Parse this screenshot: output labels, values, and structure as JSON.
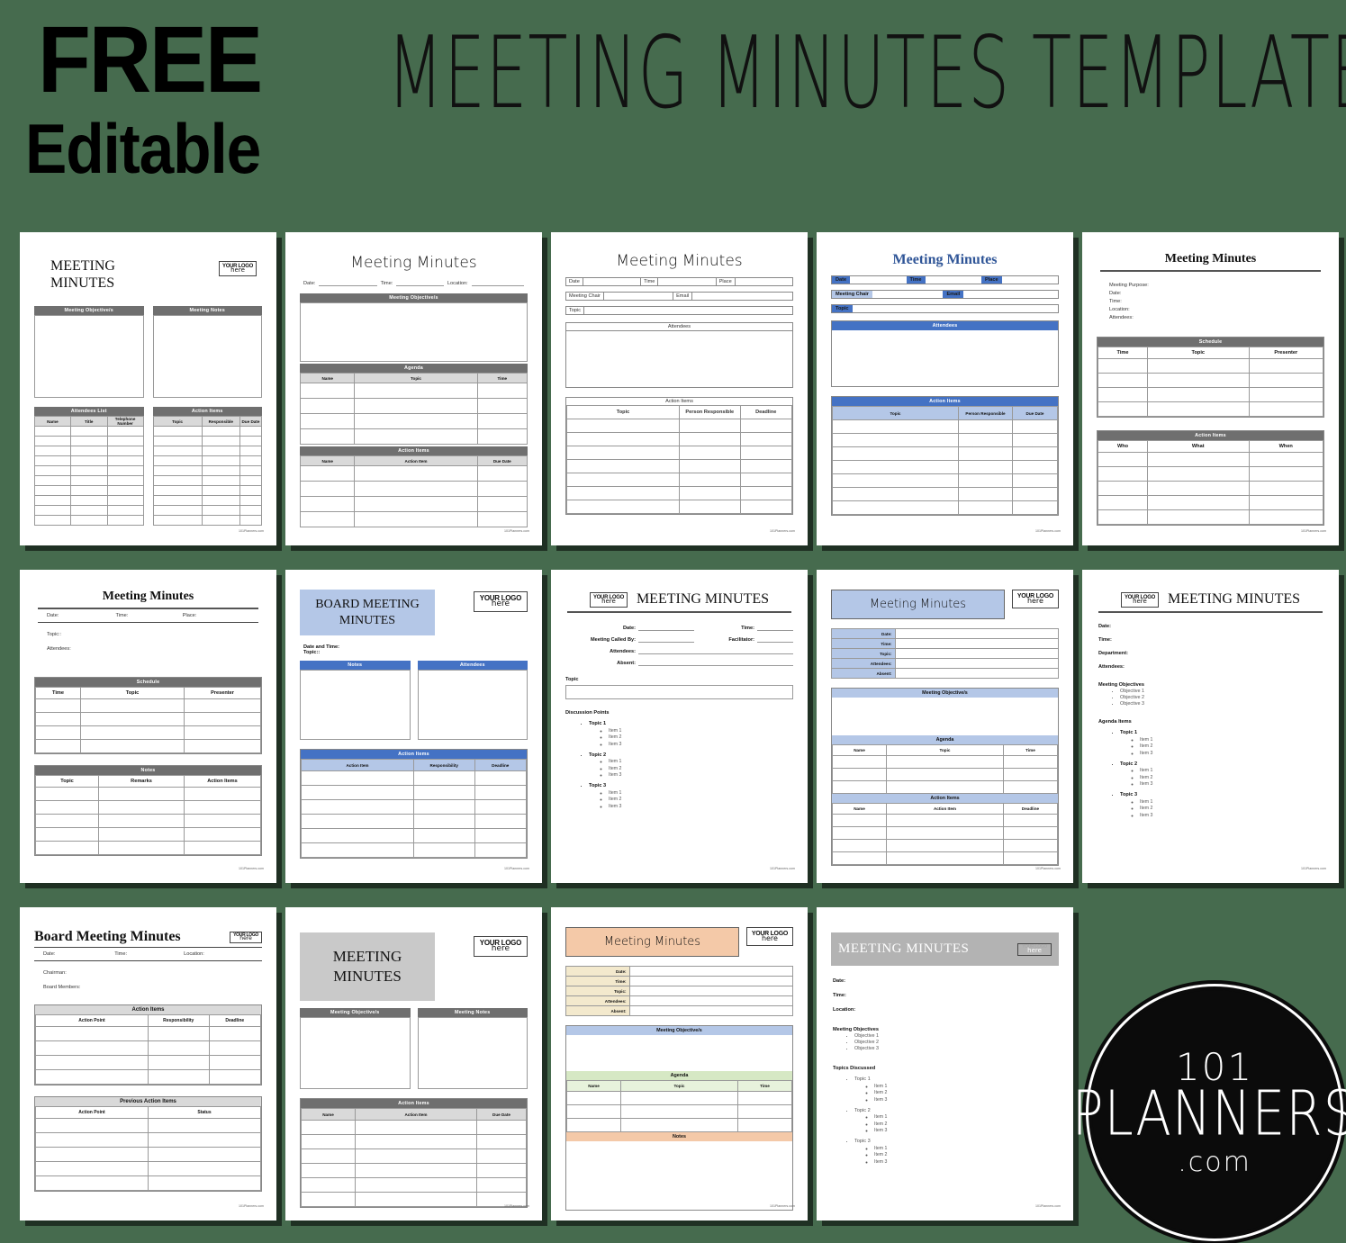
{
  "hero": {
    "free": "FREE",
    "editable": "Editable",
    "title": "MEETING MINUTES TEMPLATES"
  },
  "brand": {
    "line1": "101",
    "line2": "PLANNERS",
    "line3": ".com",
    "credit": "101Planners.com",
    "logo_placeholder_line1": "YOUR LOGO",
    "logo_placeholder_line2": "here"
  },
  "colors": {
    "background": "#466b4e",
    "gray_header": "#6f6f6f",
    "gray_subheader": "#d9d9d9",
    "blue_header": "#4472c4",
    "blue_subheader": "#b4c7e7",
    "blue_title_band": "#b4c7e7",
    "peach_band": "#f4c9a8",
    "green_band": "#d6e8c4",
    "cream_band": "#f3e9cd",
    "gray_band": "#b3b3b3"
  },
  "templates": [
    {
      "id": "t1",
      "title": "MEETING MINUTES",
      "sections": [
        "Meeting Objective/s",
        "Meeting Notes",
        "Attendees List",
        "Action Items"
      ],
      "attendees_columns": [
        "Name",
        "Title",
        "Telephone Number"
      ],
      "action_columns": [
        "Topic",
        "Responsible",
        "Due Date"
      ],
      "rows": 10
    },
    {
      "id": "t2",
      "title": "Meeting Minutes",
      "fields": [
        "Date:",
        "Time:",
        "Location:"
      ],
      "sections": [
        "Meeting Objective/s",
        "Agenda",
        "Action Items"
      ],
      "agenda_columns": [
        "Name",
        "Topic",
        "Time"
      ],
      "action_columns": [
        "Name",
        "Action Item",
        "Due Date"
      ],
      "agenda_rows": 4,
      "action_rows": 4
    },
    {
      "id": "t3",
      "title": "Meeting Minutes",
      "fields": [
        "Date",
        "Time",
        "Place",
        "Meeting Chair",
        "Email",
        "Topic"
      ],
      "sections": [
        "Attendees",
        "Action Items"
      ],
      "action_columns": [
        "Topic",
        "Person Responsible",
        "Deadline"
      ],
      "action_rows": 7
    },
    {
      "id": "t4",
      "title": "Meeting Minutes",
      "fields": [
        "Date",
        "Time",
        "Place",
        "Meeting Chair",
        "Email",
        "Topic"
      ],
      "sections": [
        "Attendees",
        "Action Items"
      ],
      "action_columns": [
        "Topic",
        "Person Responsible",
        "Due Date"
      ],
      "action_rows": 7
    },
    {
      "id": "t5",
      "title": "Meeting Minutes",
      "fields": [
        "Meeting Purpose:",
        "Date:",
        "Time:",
        "Location:",
        "Attendees:"
      ],
      "sections": [
        "Schedule",
        "Action Items"
      ],
      "schedule_columns": [
        "Time",
        "Topic",
        "Presenter"
      ],
      "action_columns": [
        "Who",
        "What",
        "When"
      ],
      "schedule_rows": 4,
      "action_rows": 5
    },
    {
      "id": "t6",
      "title": "Meeting Minutes",
      "fields": [
        "Date:",
        "Time:",
        "Place:",
        "Topic::",
        "Attendees:"
      ],
      "sections": [
        "Schedule",
        "Notes"
      ],
      "schedule_columns": [
        "Time",
        "Topic",
        "Presenter"
      ],
      "notes_columns": [
        "Topic",
        "Remarks",
        "Action Items"
      ],
      "schedule_rows": 4,
      "notes_rows": 5
    },
    {
      "id": "t7",
      "title": "BOARD MEETING MINUTES",
      "fields": [
        "Date and Time:",
        "Topic::"
      ],
      "sections": [
        "Notes",
        "Attendees",
        "Action Items"
      ],
      "action_columns": [
        "Action Item",
        "Responsibility",
        "Deadline"
      ],
      "action_rows": 6
    },
    {
      "id": "t8",
      "title": "MEETING MINUTES",
      "fields": [
        "Date:",
        "Time:",
        "Meeting Called By:",
        "Facilitator:",
        "Attendees:",
        "Absent:"
      ],
      "topic_label": "Topic",
      "discussion_label": "Discussion Points",
      "topics": [
        {
          "name": "Topic 1",
          "items": [
            "Item 1",
            "Item 2",
            "Item 3"
          ]
        },
        {
          "name": "Topic 2",
          "items": [
            "Item 1",
            "Item 2",
            "Item 3"
          ]
        },
        {
          "name": "Topic 3",
          "items": [
            "Item 1",
            "Item 2",
            "Item 3"
          ]
        }
      ]
    },
    {
      "id": "t9",
      "title": "Meeting Minutes",
      "fields": [
        "Date:",
        "Time:",
        "Topic:",
        "Attendees:",
        "Absent:"
      ],
      "sections": [
        "Meeting Objective/s",
        "Agenda",
        "Action Items"
      ],
      "agenda_columns": [
        "Name",
        "Topic",
        "Time"
      ],
      "action_columns": [
        "Name",
        "Action Item",
        "Deadline"
      ],
      "agenda_rows": 3,
      "action_rows": 4
    },
    {
      "id": "t10",
      "title": "MEETING MINUTES",
      "fields": [
        "Date:",
        "Time:",
        "Department:",
        "Attendees:"
      ],
      "objectives_label": "Meeting Objectives",
      "objectives": [
        "Objective 1",
        "Objective 2",
        "Objective 3"
      ],
      "agenda_label": "Agenda Items",
      "topics": [
        {
          "name": "Topic 1",
          "items": [
            "Item 1",
            "Item 2",
            "Item 3"
          ]
        },
        {
          "name": "Topic 2",
          "items": [
            "Item 1",
            "Item 2",
            "Item 3"
          ]
        },
        {
          "name": "Topic 3",
          "items": [
            "Item 1",
            "Item 2",
            "Item 3"
          ]
        }
      ]
    },
    {
      "id": "t11",
      "title": "Board Meeting Minutes",
      "fields": [
        "Date:",
        "Time:",
        "Location:",
        "Chairman:",
        "Board Members:"
      ],
      "sections": [
        "Action Items",
        "Previous Action Items"
      ],
      "action_columns": [
        "Action Point",
        "Responsibility",
        "Deadline"
      ],
      "previous_columns": [
        "Action Point",
        "Status"
      ],
      "action_rows": 4,
      "previous_rows": 5
    },
    {
      "id": "t12",
      "title": "MEETING MINUTES",
      "sections": [
        "Meeting Objective/s",
        "Meeting Notes",
        "Action Items"
      ],
      "action_columns": [
        "Name",
        "Action Item",
        "Due Date"
      ],
      "action_rows": 6
    },
    {
      "id": "t13",
      "title": "Meeting Minutes",
      "fields": [
        "Date:",
        "Time:",
        "Topic:",
        "Attendees:",
        "Absent:"
      ],
      "sections": [
        "Meeting Objective/s",
        "Agenda",
        "Notes"
      ],
      "agenda_columns": [
        "Name",
        "Topic",
        "Time"
      ],
      "agenda_rows": 3
    },
    {
      "id": "t14",
      "title": "MEETING MINUTES",
      "fields": [
        "Date:",
        "Time:",
        "Location:"
      ],
      "objectives_label": "Meeting Objectives",
      "objectives": [
        "Objective 1",
        "Objective 2",
        "Objective 3"
      ],
      "topics_label": "Topics Discussed",
      "topics": [
        {
          "name": "Topic 1",
          "items": [
            "Item 1",
            "Item 2",
            "Item 3"
          ]
        },
        {
          "name": "Topic 2",
          "items": [
            "Item 1",
            "Item 2",
            "Item 3"
          ]
        },
        {
          "name": "Topic 3",
          "items": [
            "Item 1",
            "Item 2",
            "Item 3"
          ]
        }
      ]
    }
  ]
}
